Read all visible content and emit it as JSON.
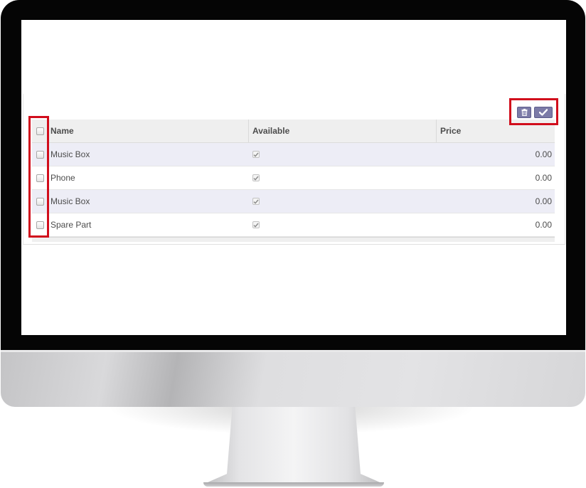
{
  "toolbar": {
    "delete_icon": "trash-icon",
    "save_icon": "check-icon",
    "button_color": "#7c7ba7"
  },
  "table": {
    "columns": [
      "Name",
      "Available",
      "Price"
    ],
    "rows": [
      {
        "name": "Music Box",
        "available": true,
        "price": "0.00"
      },
      {
        "name": "Phone",
        "available": true,
        "price": "0.00"
      },
      {
        "name": "Music Box",
        "available": true,
        "price": "0.00"
      },
      {
        "name": "Spare Part",
        "available": true,
        "price": "0.00"
      }
    ]
  },
  "colors": {
    "row_stripe": "#ededf6",
    "header_bg": "#efefef",
    "highlight": "#d10d1c"
  }
}
